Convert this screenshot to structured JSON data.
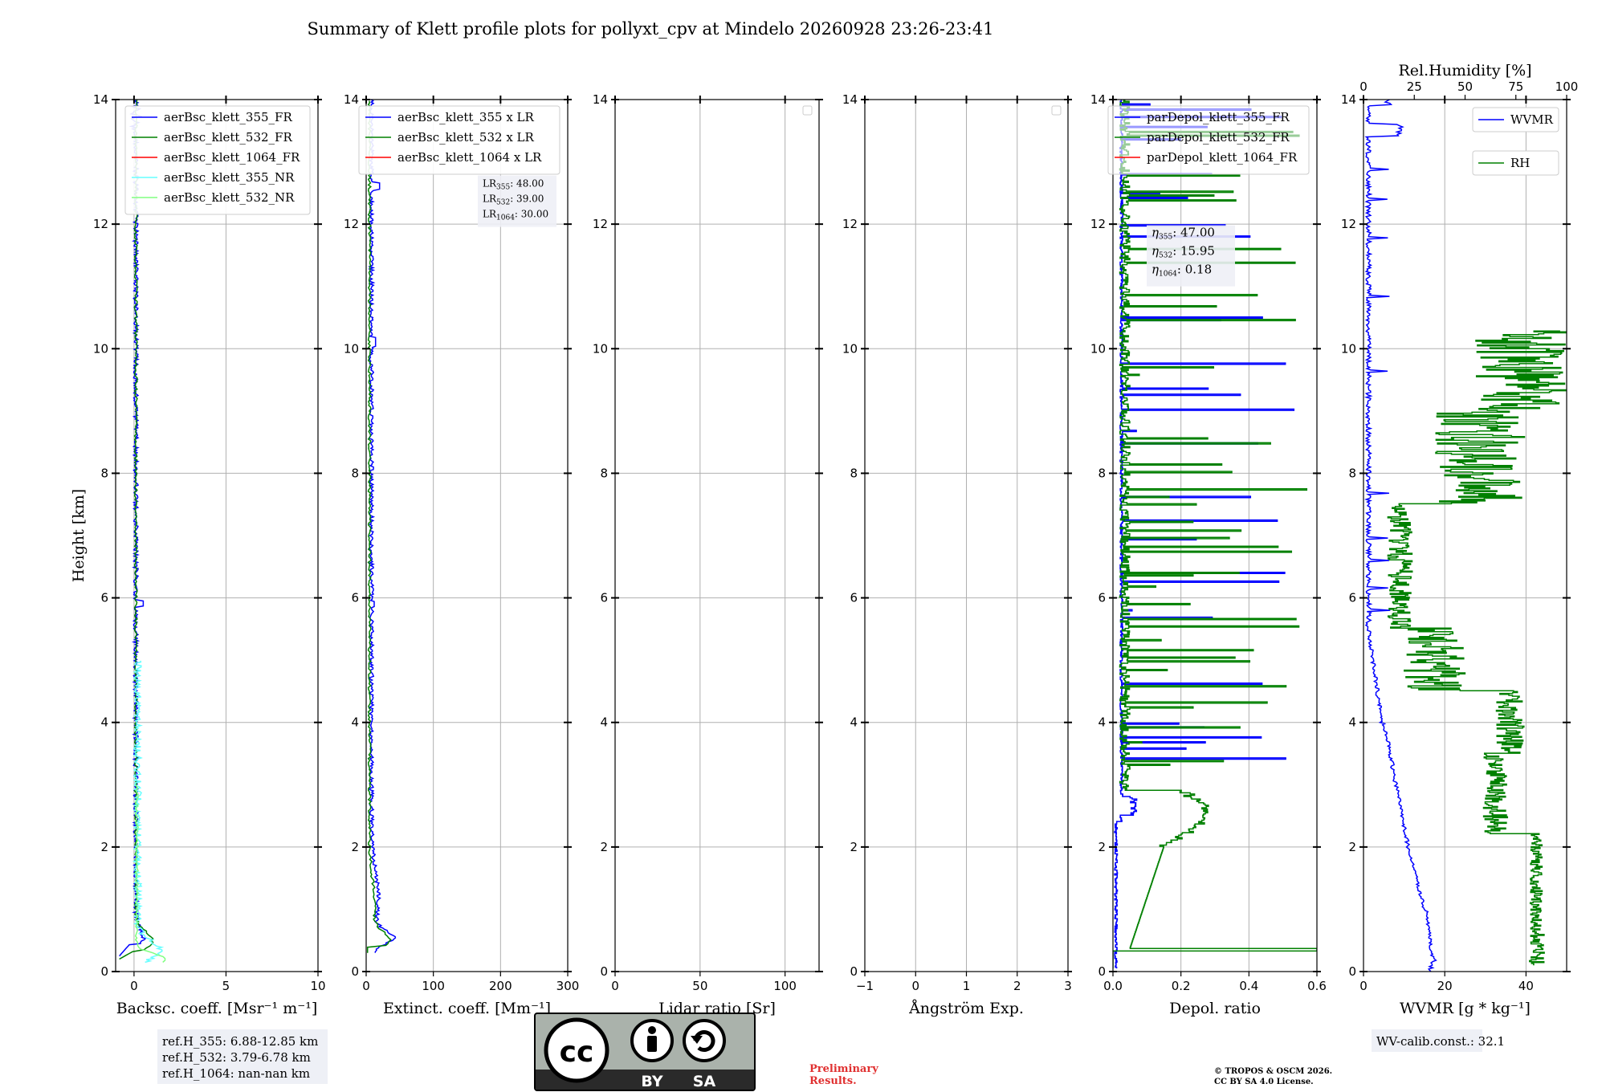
{
  "title": "Summary of Klett profile plots for pollyxt_cpv at Mindelo 20260928 23:26-23:41",
  "colors": {
    "b355": "#0000ff",
    "g532": "#008000",
    "r1064": "#ff0000",
    "cyan": "#66ffff",
    "lime": "#80ff80",
    "grid": "#b0b0b0"
  },
  "footer": {
    "ref_lines": [
      "ref.H_355: 6.88-12.85 km",
      "ref.H_532: 3.79-6.78 km",
      "ref.H_1064: nan-nan km"
    ],
    "license_badge": {
      "by": "BY",
      "sa": "SA",
      "icon": "cc-by-sa-logo"
    },
    "preliminary": [
      "Preliminary",
      "Results."
    ],
    "copyright": [
      "© TROPOS & OSCM 2026.",
      "CC BY SA 4.0 License."
    ],
    "wv_calib": "WV-calib.const.: 32.1"
  },
  "chart_data": [
    {
      "id": "bsc",
      "type": "line",
      "xlabel": "Backsc. coeff. [Msr⁻¹ m⁻¹]",
      "ylabel": "Height [km]",
      "xlim": [
        -1,
        10
      ],
      "ylim": [
        0,
        14
      ],
      "xticks": [
        0,
        5,
        10
      ],
      "yticks": [
        0,
        2,
        4,
        6,
        8,
        10,
        12,
        14
      ],
      "grid": true,
      "legend": {
        "location": "upper-right"
      },
      "series": [
        {
          "name": "aerBsc_klett_355_FR",
          "color": "b355",
          "gen": "bsc355"
        },
        {
          "name": "aerBsc_klett_532_FR",
          "color": "g532",
          "gen": "bsc532"
        },
        {
          "name": "aerBsc_klett_1064_FR",
          "color": "r1064",
          "gen": "none"
        },
        {
          "name": "aerBsc_klett_355_NR",
          "color": "cyan",
          "gen": "bsc355nr"
        },
        {
          "name": "aerBsc_klett_532_NR",
          "color": "lime",
          "gen": "bsc532nr"
        }
      ]
    },
    {
      "id": "ext",
      "type": "line",
      "xlabel": "Extinct. coeff. [Mm⁻¹]",
      "xlim": [
        0,
        300
      ],
      "ylim": [
        0,
        14
      ],
      "xticks": [
        0,
        100,
        200,
        300
      ],
      "yticks": [
        0,
        2,
        4,
        6,
        8,
        10,
        12,
        14
      ],
      "grid": true,
      "legend": {
        "location": "upper-right"
      },
      "series": [
        {
          "name": "aerBsc_klett_355 x LR",
          "color": "b355",
          "gen": "ext355"
        },
        {
          "name": "aerBsc_klett_532 x LR",
          "color": "g532",
          "gen": "ext532"
        },
        {
          "name": "aerBsc_klett_1064 x LR",
          "color": "r1064",
          "gen": "none"
        }
      ],
      "annotation": [
        {
          "label": "LR",
          "sub": "355",
          "value": ": 48.00"
        },
        {
          "label": "LR",
          "sub": "532",
          "value": ": 39.00"
        },
        {
          "label": "LR",
          "sub": "1064",
          "value": ": 30.00"
        }
      ]
    },
    {
      "id": "lr",
      "type": "line",
      "xlabel": "Lidar ratio [Sr]",
      "xlim": [
        0,
        120
      ],
      "ylim": [
        0,
        14
      ],
      "xticks": [
        0,
        50,
        100
      ],
      "yticks": [
        0,
        2,
        4,
        6,
        8,
        10,
        12,
        14
      ],
      "grid": true,
      "legend": {
        "location": "upper-right",
        "empty": true
      },
      "series": []
    },
    {
      "id": "ae",
      "type": "line",
      "xlabel": "Ångström Exp.",
      "xlim": [
        -1,
        3
      ],
      "ylim": [
        0,
        14
      ],
      "xticks": [
        -1,
        0,
        1,
        2,
        3
      ],
      "yticks": [
        0,
        2,
        4,
        6,
        8,
        10,
        12,
        14
      ],
      "grid": true,
      "legend": {
        "location": "upper-right",
        "empty": true
      },
      "series": []
    },
    {
      "id": "dep",
      "type": "line",
      "xlabel": "Depol. ratio",
      "xlim": [
        0,
        0.6
      ],
      "ylim": [
        0,
        14
      ],
      "xticks": [
        0.0,
        0.2,
        0.4,
        0.6
      ],
      "yticks": [
        0,
        2,
        4,
        6,
        8,
        10,
        12,
        14
      ],
      "grid": true,
      "legend": {
        "location": "upper-right"
      },
      "series": [
        {
          "name": "parDepol_klett_355_FR",
          "color": "b355",
          "gen": "dep355"
        },
        {
          "name": "parDepol_klett_532_FR",
          "color": "g532",
          "gen": "dep532"
        },
        {
          "name": "parDepol_klett_1064_FR",
          "color": "r1064",
          "gen": "none"
        }
      ],
      "annotation": [
        {
          "label": "η",
          "sub": "355",
          "value": ": 47.00"
        },
        {
          "label": "η",
          "sub": "532",
          "value": ": 15.95"
        },
        {
          "label": "η",
          "sub": "1064",
          "value": ": 0.18"
        }
      ]
    },
    {
      "id": "wv",
      "type": "line",
      "xlabel": "WVMR [g * kg⁻¹]",
      "x2label": "Rel.Humidity [%]",
      "xlim": [
        0,
        50
      ],
      "x2lim": [
        0,
        100
      ],
      "ylim": [
        0,
        14
      ],
      "xticks": [
        0,
        20,
        40
      ],
      "x2ticks": [
        0,
        25,
        50,
        75,
        100
      ],
      "yticks": [
        0,
        2,
        4,
        6,
        8,
        10,
        12,
        14
      ],
      "grid": true,
      "series": [
        {
          "name": "WVMR",
          "color": "b355",
          "gen": "wvmr",
          "legend_location": "upper-right"
        },
        {
          "name": "RH",
          "color": "g532",
          "gen": "rh",
          "axis": "x2",
          "legend_location": "upper-right"
        }
      ]
    }
  ]
}
